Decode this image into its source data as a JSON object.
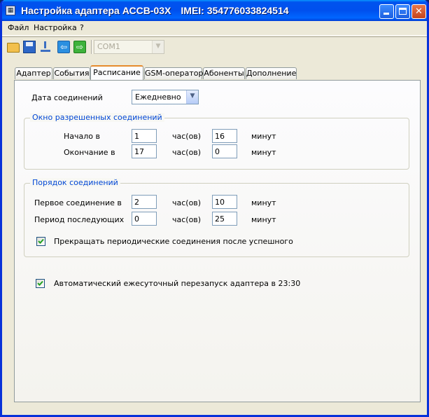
{
  "window": {
    "title": "Настройка адаптера АССВ-03Х",
    "imei": "IMEI: 354776033824514"
  },
  "menu": [
    "Файл",
    "Настройка",
    "?"
  ],
  "toolbar": {
    "icons": [
      "folder-icon",
      "save-icon",
      "download-icon",
      "arrow-left-icon",
      "arrow-right-icon"
    ],
    "port": "COM1"
  },
  "tabs": [
    "Адаптер",
    "События",
    "Расписание",
    "GSM-оператор",
    "Абоненты",
    "Дополнение"
  ],
  "active_tab": "Расписание",
  "schedule": {
    "date_label": "Дата соединений",
    "date_value": "Ежедневно",
    "window_group": {
      "title": "Окно разрешенных соединений",
      "start_label": "Начало в",
      "start_hours": "1",
      "start_minutes": "16",
      "end_label": "Окончание в",
      "end_hours": "17",
      "end_minutes": "0"
    },
    "order_group": {
      "title": "Порядок соединений",
      "first_label": "Первое соединение в",
      "first_hours": "2",
      "first_minutes": "10",
      "period_label": "Период последующих",
      "period_hours": "0",
      "period_minutes": "25",
      "stop_label": "Прекращать периодические соединения после успешного",
      "stop_checked": true
    },
    "units": {
      "hours": "час(ов)",
      "minutes": "минут"
    },
    "restart_label": "Автоматический ежесуточный перезапуск адаптера в 23:30",
    "restart_checked": true
  },
  "colors": {
    "accent": "#0046d5",
    "active_tab_highlight": "#e68b2c",
    "titlebar": "#0053ee",
    "check": "#21a121"
  }
}
